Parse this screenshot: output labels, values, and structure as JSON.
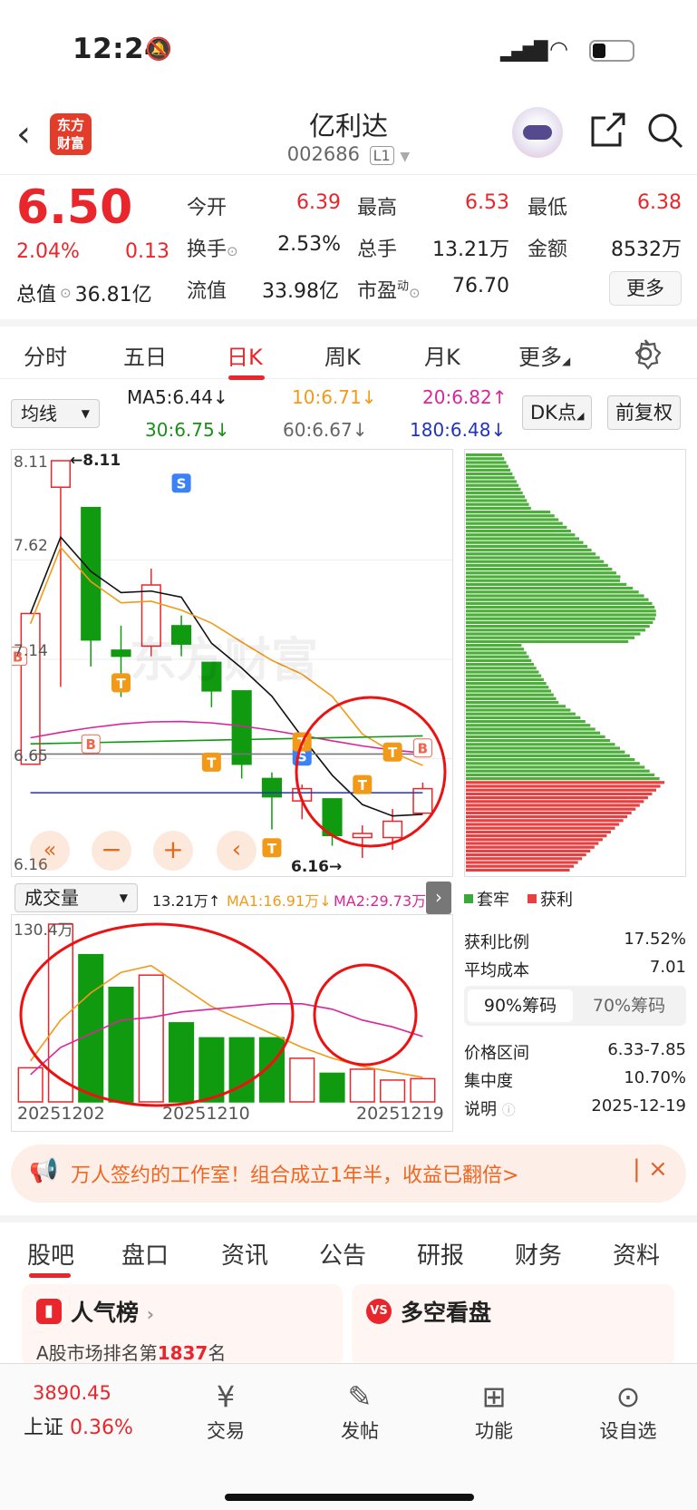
{
  "status_bar": {
    "time": "12:24"
  },
  "header": {
    "logo_text": "东方财富",
    "stock_name": "亿利达",
    "stock_code": "002686",
    "level_badge": "L1"
  },
  "quote": {
    "price": "6.50",
    "change_pct": "2.04%",
    "change_amt": "0.13",
    "open_label": "今开",
    "open": "6.39",
    "high_label": "最高",
    "high": "6.53",
    "low_label": "最低",
    "low": "6.38",
    "turnover_label": "换手",
    "turnover": "2.53%",
    "volume_label": "总手",
    "volume": "13.21万",
    "amount_label": "金额",
    "amount": "8532万",
    "mcap_label": "总值",
    "mcap": "36.81亿",
    "float_label": "流值",
    "float_cap": "33.98亿",
    "pe_label": "市盈",
    "pe_sup": "动",
    "pe": "76.70",
    "more_label": "更多"
  },
  "tabs": [
    "分时",
    "五日",
    "日K",
    "周K",
    "月K",
    "更多"
  ],
  "ma": {
    "selector": "均线",
    "ma5": "MA5:6.44",
    "ma10": "10:6.71",
    "ma20": "20:6.82",
    "ma30": "30:6.75",
    "ma60": "60:6.67",
    "ma180": "180:6.48",
    "dk_button": "DK点",
    "adjust_button": "前复权"
  },
  "kline": {
    "y_labels": [
      "8.11",
      "7.62",
      "7.14",
      "6.65",
      "6.16"
    ],
    "high_marker": "←8.11",
    "low_marker": "6.16→",
    "watermark": "东方财富",
    "markers": {
      "b": "B",
      "s": "S",
      "t": "T"
    }
  },
  "chart_data": {
    "type": "candlestick",
    "ylim": [
      6.16,
      8.11
    ],
    "candles": [
      {
        "o": 6.62,
        "c": 7.36,
        "h": 7.36,
        "l": 6.62,
        "up": true
      },
      {
        "o": 7.98,
        "c": 8.11,
        "h": 8.11,
        "l": 7.0,
        "up": true
      },
      {
        "o": 7.88,
        "c": 7.23,
        "h": 7.88,
        "l": 7.1,
        "up": false
      },
      {
        "o": 7.18,
        "c": 7.15,
        "h": 7.3,
        "l": 6.95,
        "up": false
      },
      {
        "o": 7.2,
        "c": 7.5,
        "h": 7.58,
        "l": 7.15,
        "up": true
      },
      {
        "o": 7.3,
        "c": 7.21,
        "h": 7.35,
        "l": 7.15,
        "up": false
      },
      {
        "o": 7.12,
        "c": 6.98,
        "h": 7.12,
        "l": 6.9,
        "up": false
      },
      {
        "o": 6.98,
        "c": 6.62,
        "h": 6.98,
        "l": 6.55,
        "up": false
      },
      {
        "o": 6.55,
        "c": 6.46,
        "h": 6.58,
        "l": 6.3,
        "up": false
      },
      {
        "o": 6.44,
        "c": 6.5,
        "h": 6.52,
        "l": 6.35,
        "up": true
      },
      {
        "o": 6.45,
        "c": 6.27,
        "h": 6.45,
        "l": 6.22,
        "up": false
      },
      {
        "o": 6.28,
        "c": 6.26,
        "h": 6.32,
        "l": 6.16,
        "up": true
      },
      {
        "o": 6.26,
        "c": 6.34,
        "h": 6.4,
        "l": 6.2,
        "up": true
      },
      {
        "o": 6.38,
        "c": 6.5,
        "h": 6.53,
        "l": 6.38,
        "up": true
      }
    ],
    "volume": {
      "unit": "万",
      "max_label": "130.4万",
      "values": [
        25,
        130.4,
        108,
        84,
        93,
        58,
        47,
        47,
        47,
        32,
        21,
        24,
        16,
        17
      ],
      "dates": [
        "20251202",
        "20251210",
        "20251219"
      ]
    }
  },
  "volume_bar": {
    "selector": "成交量",
    "vol": "13.21万",
    "ma1": "MA1:16.91万",
    "ma2": "MA2:29.73万"
  },
  "chips": {
    "legend_trapped": "套牢",
    "legend_profit": "获利",
    "profit_ratio_label": "获利比例",
    "profit_ratio": "17.52%",
    "avg_cost_label": "平均成本",
    "avg_cost": "7.01",
    "tab90": "90%筹码",
    "tab70": "70%筹码",
    "price_range_label": "价格区间",
    "price_range": "6.33-7.85",
    "concentration_label": "集中度",
    "concentration": "10.70%",
    "note_label": "说明",
    "note_date": "2025-12-19"
  },
  "banner": {
    "text": "万人签约的工作室！组合成立1年半，收益已翻倍>"
  },
  "bottom_tabs": [
    "股吧",
    "盘口",
    "资讯",
    "公告",
    "研报",
    "财务",
    "资料"
  ],
  "cards": {
    "popular_title": "人气榜",
    "popular_sub_prefix": "A股市场排名第",
    "popular_rank": "1837",
    "popular_sub_suffix": "名",
    "bullbear_title": "多空看盘"
  },
  "footer": {
    "index_value": "3890.45",
    "index_name": "上证",
    "index_change": "0.36%",
    "trade": "交易",
    "post": "发帖",
    "function": "功能",
    "watchlist": "设自选"
  },
  "colors": {
    "up": "#e8262b",
    "down": "#109a10",
    "accent": "#e8262b"
  }
}
